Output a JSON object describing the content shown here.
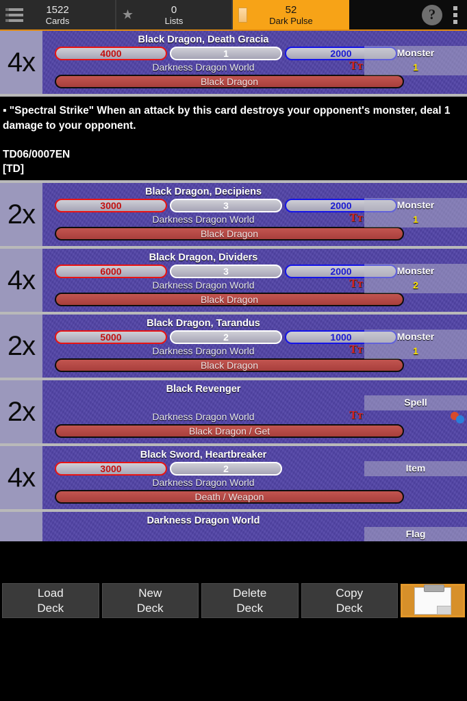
{
  "topbar": {
    "tabs": [
      {
        "icon": "list-icon",
        "count": "1522",
        "label": "Cards",
        "active": false
      },
      {
        "icon": "star-icon",
        "count": "0",
        "label": "Lists",
        "active": false
      },
      {
        "icon": "bookmark-icon",
        "count": "52",
        "label": "Dark Pulse",
        "active": true
      }
    ],
    "help_label": "?",
    "accent_color": "#f7a317"
  },
  "cards": [
    {
      "qty": "4x",
      "name": "Black Dragon, Death Gracia",
      "atk": "4000",
      "crit": "1",
      "def": "2000",
      "world": "Darkness Dragon World",
      "attribute": "Black Dragon",
      "type_label": "Monster",
      "type_value": "1",
      "text_icon": "Tт",
      "has_badges": false
    },
    {
      "qty": "2x",
      "name": "Black Dragon, Decipiens",
      "atk": "3000",
      "crit": "3",
      "def": "2000",
      "world": "Darkness Dragon World",
      "attribute": "Black Dragon",
      "type_label": "Monster",
      "type_value": "1",
      "text_icon": "Tт",
      "has_badges": false
    },
    {
      "qty": "4x",
      "name": "Black Dragon, Dividers",
      "atk": "6000",
      "crit": "3",
      "def": "2000",
      "world": "Darkness Dragon World",
      "attribute": "Black Dragon",
      "type_label": "Monster",
      "type_value": "2",
      "text_icon": "Tт",
      "has_badges": false
    },
    {
      "qty": "2x",
      "name": "Black Dragon, Tarandus",
      "atk": "5000",
      "crit": "2",
      "def": "1000",
      "world": "Darkness Dragon World",
      "attribute": "Black Dragon",
      "type_label": "Monster",
      "type_value": "1",
      "text_icon": "Tт",
      "has_badges": false
    },
    {
      "qty": "2x",
      "name": "Black Revenger",
      "atk": "",
      "crit": "",
      "def": "",
      "world": "Darkness Dragon World",
      "attribute": "Black Dragon / Get",
      "type_label": "Spell",
      "type_value": "",
      "text_icon": "Tт",
      "has_badges": true
    },
    {
      "qty": "4x",
      "name": "Black Sword, Heartbreaker",
      "atk": "3000",
      "crit": "2",
      "def": "",
      "world": "Darkness Dragon World",
      "attribute": "Death / Weapon",
      "type_label": "Item",
      "type_value": "",
      "text_icon": "",
      "has_badges": false
    },
    {
      "qty": "",
      "name": "Darkness Dragon World",
      "atk": "",
      "crit": "",
      "def": "",
      "world": "",
      "attribute": "",
      "type_label": "Flag",
      "type_value": "",
      "text_icon": "",
      "has_badges": false
    }
  ],
  "description": {
    "effect": "▪ \"Spectral Strike\" When an attack by this card destroys your opponent's monster, deal 1 damage to your opponent.",
    "card_number": "TD06/0007EN",
    "set_code": "[TD]"
  },
  "bottom_buttons": [
    {
      "line1": "Load",
      "line2": "Deck"
    },
    {
      "line1": "New",
      "line2": "Deck"
    },
    {
      "line1": "Delete",
      "line2": "Deck"
    },
    {
      "line1": "Copy",
      "line2": "Deck"
    }
  ],
  "clipboard_button": {
    "icon": "clipboard-icon"
  }
}
